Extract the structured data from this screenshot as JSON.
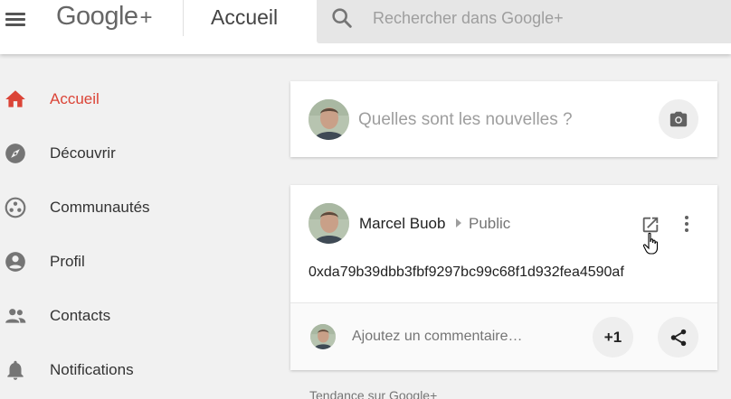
{
  "header": {
    "logo_text": "Google",
    "logo_plus": "+",
    "page_title": "Accueil",
    "search_placeholder": "Rechercher dans Google+"
  },
  "sidebar": {
    "items": [
      {
        "label": "Accueil",
        "icon": "home-icon",
        "active": true
      },
      {
        "label": "Découvrir",
        "icon": "compass-icon",
        "active": false
      },
      {
        "label": "Communautés",
        "icon": "communities-icon",
        "active": false
      },
      {
        "label": "Profil",
        "icon": "profile-icon",
        "active": false
      },
      {
        "label": "Contacts",
        "icon": "people-icon",
        "active": false
      },
      {
        "label": "Notifications",
        "icon": "bell-icon",
        "active": false
      }
    ]
  },
  "compose": {
    "prompt": "Quelles sont les nouvelles ?",
    "icon": "camera-icon"
  },
  "post": {
    "author": "Marcel Buob",
    "visibility": "Public",
    "body": "0xda79b39dbb3fbf9297bc99c68f1d932fea4590af",
    "comment_placeholder": "Ajoutez un commentaire…",
    "plus_one_label": "+1"
  },
  "feed": {
    "trending_label": "Tendance sur Google+"
  },
  "colors": {
    "accent": "#db4437",
    "icon_gray": "#757575",
    "background": "#f1f1f1"
  }
}
